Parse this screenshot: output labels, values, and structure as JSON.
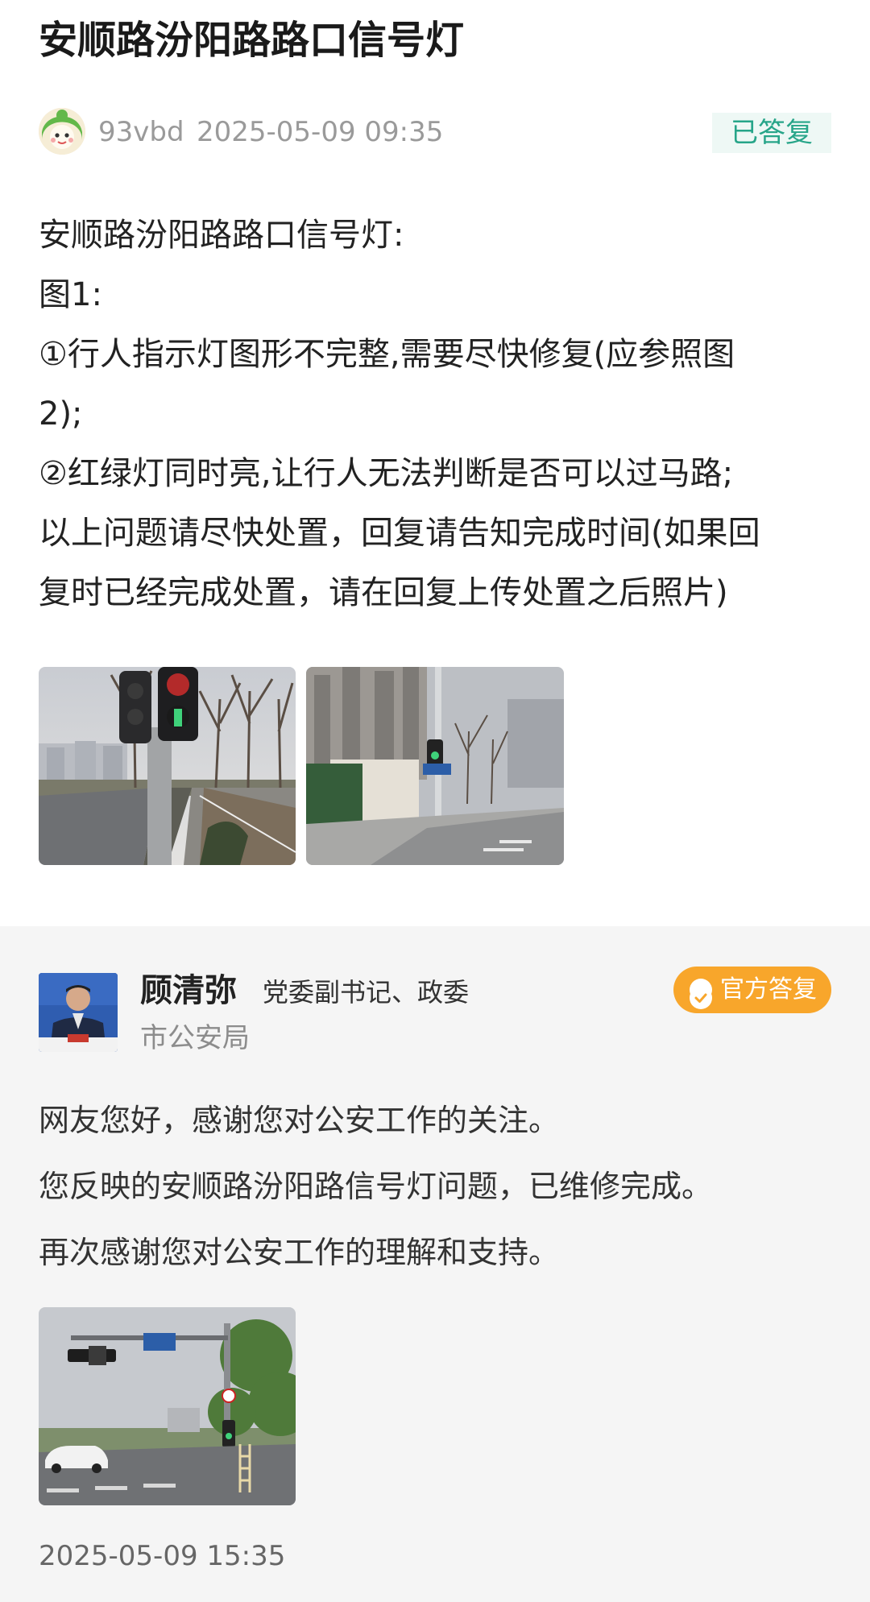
{
  "post": {
    "title": "安顺路汾阳路路口信号灯",
    "author": "93vbd",
    "time": "2025-05-09 09:35",
    "status": "已答复",
    "body_lines": [
      "安顺路汾阳路路口信号灯:",
      "图1:",
      "①行人指示灯图形不完整,需要尽快修复(应参照图",
      "2);",
      "②红绿灯同时亮,让行人无法判断是否可以过马路;",
      "以上问题请尽快处置，回复请告知完成时间(如果回",
      "复时已经完成处置，请在回复上传处置之后照片)"
    ]
  },
  "reply": {
    "name": "顾清弥",
    "title": "党委副书记、政委",
    "department": "市公安局",
    "badge": "官方答复",
    "lines": [
      "网友您好，感谢您对公安工作的关注。",
      "您反映的安顺路汾阳路信号灯问题，已维修完成。",
      "再次感谢您对公安工作的理解和支持。"
    ],
    "time": "2025-05-09 15:35"
  },
  "icons": {
    "badge_icon": "check-circle-icon"
  },
  "colors": {
    "status_green": "#27a589",
    "official_orange": "#f8a62b",
    "reply_bg": "#f5f5f5"
  }
}
